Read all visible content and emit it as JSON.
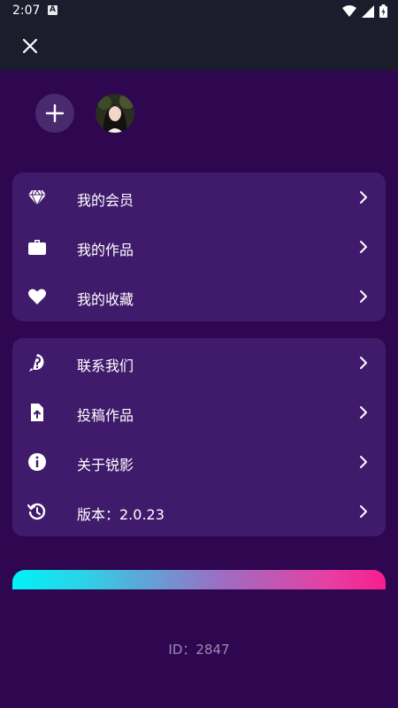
{
  "status_bar": {
    "time": "2:07",
    "notification_icon": "a-icon",
    "icons": [
      "wifi-icon",
      "signal-icon",
      "battery-icon"
    ]
  },
  "header": {
    "close_icon": "close-icon"
  },
  "profile": {
    "add_icon": "plus-icon",
    "avatar_icon": "avatar"
  },
  "menu_group_1": [
    {
      "label": "我的会员",
      "icon": "diamond-icon"
    },
    {
      "label": "我的作品",
      "icon": "briefcase-icon"
    },
    {
      "label": "我的收藏",
      "icon": "heart-icon"
    }
  ],
  "menu_group_2": [
    {
      "label": "联系我们",
      "icon": "help-icon"
    },
    {
      "label": "投稿作品",
      "icon": "upload-file-icon"
    },
    {
      "label": "关于锐影",
      "icon": "info-icon"
    },
    {
      "label": "版本：2.0.23",
      "icon": "history-icon"
    }
  ],
  "footer": {
    "id_text": "ID：2847"
  },
  "colors": {
    "background": "#2e0750",
    "header": "#1b1d2d",
    "card": "#401b6c",
    "gradient_start": "#00f2f6",
    "gradient_end": "#f71e8e",
    "id_text": "#9b8bb3"
  }
}
